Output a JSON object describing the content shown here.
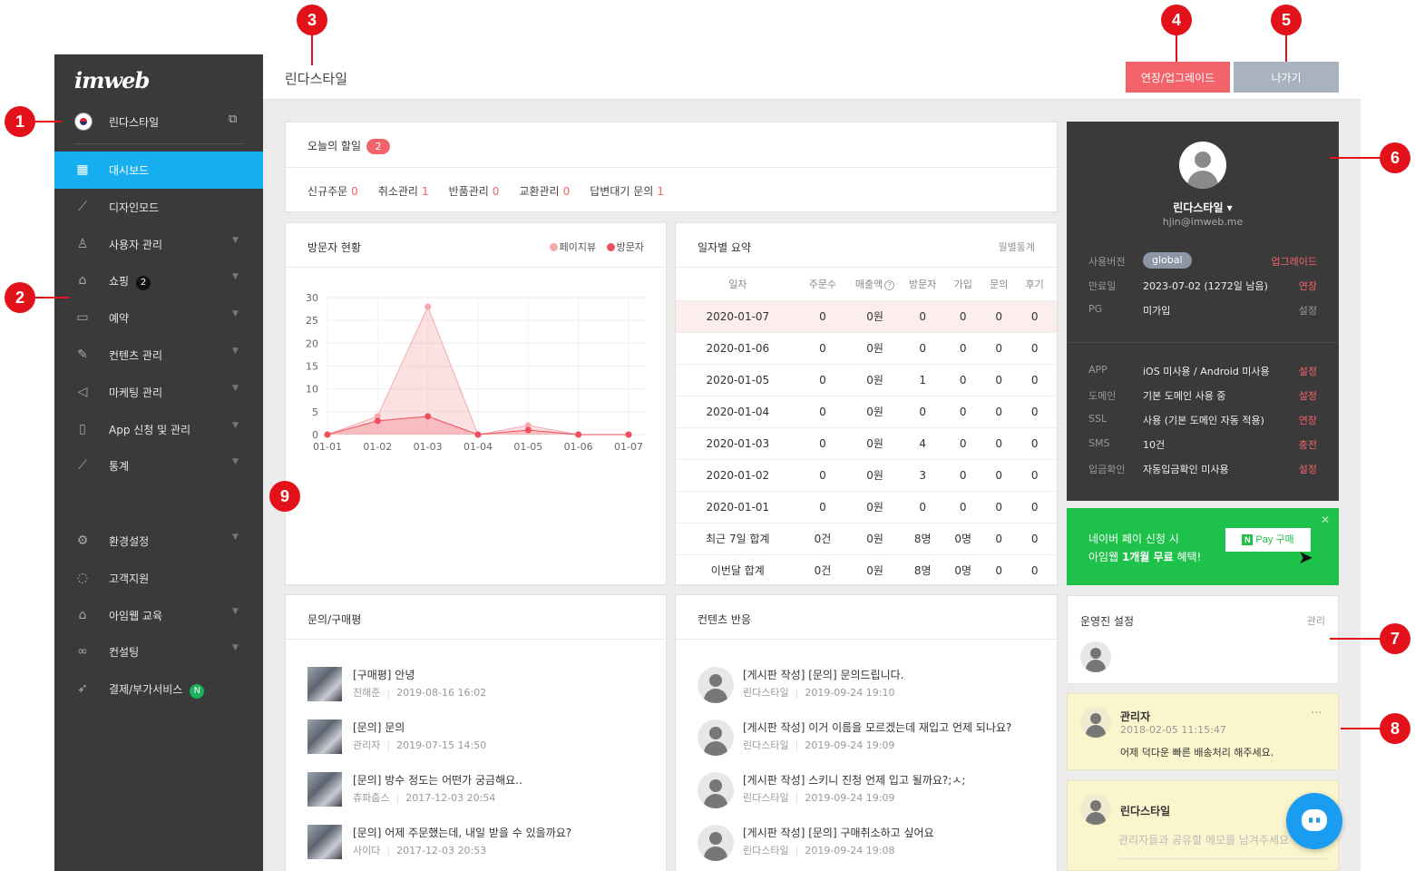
{
  "brand": {
    "logo": "imweb"
  },
  "site": {
    "name": "린다스타일"
  },
  "sidebar": {
    "items": [
      {
        "label": "대시보드",
        "icon": "dashboard-icon",
        "active": true
      },
      {
        "label": "디자인모드",
        "icon": "magic-wand-icon"
      },
      {
        "label": "사용자 관리",
        "icon": "user-icon",
        "chevron": true
      },
      {
        "label": "쇼핑",
        "icon": "shopping-bag-icon",
        "chevron": true,
        "badge": "2"
      },
      {
        "label": "예약",
        "icon": "calendar-icon",
        "chevron": true
      },
      {
        "label": "컨텐츠 관리",
        "icon": "edit-icon",
        "chevron": true
      },
      {
        "label": "마케팅 관리",
        "icon": "megaphone-icon",
        "chevron": true
      },
      {
        "label": "App 신청 및 관리",
        "icon": "mobile-icon",
        "chevron": true
      },
      {
        "label": "통계",
        "icon": "stats-icon",
        "chevron": true
      }
    ],
    "items2": [
      {
        "label": "환경설정",
        "icon": "gear-icon",
        "chevron": true
      },
      {
        "label": "고객지원",
        "icon": "chat-icon"
      },
      {
        "label": "아임웹 교육",
        "icon": "graduation-icon",
        "chevron": true
      },
      {
        "label": "컨설팅",
        "icon": "glasses-icon",
        "chevron": true
      },
      {
        "label": "결제/부가서비스",
        "icon": "rocket-icon",
        "badge": "N"
      }
    ]
  },
  "header": {
    "title": "린다스타일",
    "upgrade_label": "연장/업그레이드",
    "exit_label": "나가기"
  },
  "today": {
    "title": "오늘의 할일",
    "count": "2",
    "items": [
      {
        "label": "신규주문",
        "value": "0"
      },
      {
        "label": "취소관리",
        "value": "1"
      },
      {
        "label": "반품관리",
        "value": "0"
      },
      {
        "label": "교환관리",
        "value": "0"
      },
      {
        "label": "답변대기 문의",
        "value": "1"
      }
    ]
  },
  "visitors": {
    "title": "방문자 현황",
    "legend_pageview": "페이지뷰",
    "legend_visitor": "방문자"
  },
  "chart_data": {
    "type": "area",
    "categories": [
      "01-01",
      "01-02",
      "01-03",
      "01-04",
      "01-05",
      "01-06",
      "01-07"
    ],
    "series": [
      {
        "name": "페이지뷰",
        "values": [
          0,
          4,
          28,
          0,
          2,
          0,
          0
        ],
        "color": "#f7a8ad"
      },
      {
        "name": "방문자",
        "values": [
          0,
          3,
          4,
          0,
          1,
          0,
          0
        ],
        "color": "#f04e5c"
      }
    ],
    "ylim": [
      0,
      30
    ],
    "yticks": [
      0,
      5,
      10,
      15,
      20,
      25,
      30
    ],
    "grid": true,
    "legend": "top-right"
  },
  "daily": {
    "title": "일자별 요약",
    "monthly_label": "월별통계",
    "headers": [
      "일자",
      "주문수",
      "매출액",
      "방문자",
      "가입",
      "문의",
      "후기"
    ],
    "help_icon": "question-circle-icon",
    "rows": [
      [
        "2020-01-07",
        "0",
        "0원",
        "0",
        "0",
        "0",
        "0"
      ],
      [
        "2020-01-06",
        "0",
        "0원",
        "0",
        "0",
        "0",
        "0"
      ],
      [
        "2020-01-05",
        "0",
        "0원",
        "1",
        "0",
        "0",
        "0"
      ],
      [
        "2020-01-04",
        "0",
        "0원",
        "0",
        "0",
        "0",
        "0"
      ],
      [
        "2020-01-03",
        "0",
        "0원",
        "4",
        "0",
        "0",
        "0"
      ],
      [
        "2020-01-02",
        "0",
        "0원",
        "3",
        "0",
        "0",
        "0"
      ],
      [
        "2020-01-01",
        "0",
        "0원",
        "0",
        "0",
        "0",
        "0"
      ],
      [
        "최근 7일 합계",
        "0건",
        "0원",
        "8명",
        "0명",
        "0",
        "0"
      ],
      [
        "이번달 합계",
        "0건",
        "0원",
        "8명",
        "0명",
        "0",
        "0"
      ]
    ]
  },
  "inquiries": {
    "title": "문의/구매평",
    "items": [
      {
        "title": "[구매평] 안녕",
        "author": "진해준",
        "date": "2019-08-16 16:02"
      },
      {
        "title": "[문의] 문의",
        "author": "관리자",
        "date": "2019-07-15 14:50"
      },
      {
        "title": "[문의] 방수 정도는 어떤가 궁금해요..",
        "author": "츄파춥스",
        "date": "2017-12-03 20:54"
      },
      {
        "title": "[문의] 어제 주문했는데, 내일 받을 수 있을까요?",
        "author": "사이다",
        "date": "2017-12-03 20:53"
      }
    ]
  },
  "reactions": {
    "title": "컨텐츠 반응",
    "items": [
      {
        "title": "[게시판 작성] [문의] 문의드립니다.",
        "author": "린다스타일",
        "date": "2019-09-24 19:10"
      },
      {
        "title": "[게시판 작성] 이거 이름을 모르겠는데 재입고 언제 되나요?",
        "author": "린다스타일",
        "date": "2019-09-24 19:09"
      },
      {
        "title": "[게시판 작성] 스키니 진청 언제 입고 될까요?;ㅅ;",
        "author": "린다스타일",
        "date": "2019-09-24 19:09"
      },
      {
        "title": "[게시판 작성] [문의] 구매취소하고 싶어요",
        "author": "린다스타일",
        "date": "2019-09-24 19:08"
      }
    ]
  },
  "profile": {
    "name": "린다스타일",
    "email": "hjin@imweb.me",
    "rows1": [
      {
        "key": "사용버전",
        "pill": "global",
        "action": "업그레이드"
      },
      {
        "key": "만료일",
        "value": "2023-07-02 (1272일 남음)",
        "action": "연장"
      },
      {
        "key": "PG",
        "value": "미가입",
        "action": "설정",
        "gray": true
      }
    ],
    "rows2": [
      {
        "key": "APP",
        "value": "iOS 미사용 / Android 미사용",
        "action": "설정"
      },
      {
        "key": "도메인",
        "value": "기본 도메인 사용 중",
        "action": "설정"
      },
      {
        "key": "SSL",
        "value": "사용 (기본 도메인 자동 적용)",
        "action": "연장"
      },
      {
        "key": "SMS",
        "value": "10건",
        "action": "충전"
      },
      {
        "key": "입금확인",
        "value": "자동입금확인 미사용",
        "action": "설정"
      }
    ]
  },
  "naver": {
    "line1": "네이버 페이 신청 시",
    "line2": "아임웹 1개월 무료 혜택!",
    "button": "Pay 구매",
    "button_n": "N"
  },
  "operators": {
    "title": "운영진 설정",
    "manage": "관리"
  },
  "memo": {
    "name": "관리자",
    "date": "2018-02-05 11:15:47",
    "text": "어제 덕다운 빠른 배송처리 해주세요.",
    "more": "···"
  },
  "memo2": {
    "name": "린다스타일",
    "placeholder": "관리자들과 공유할 메모를 남겨주세요"
  },
  "markers": [
    "1",
    "2",
    "3",
    "4",
    "5",
    "6",
    "7",
    "8",
    "9"
  ]
}
